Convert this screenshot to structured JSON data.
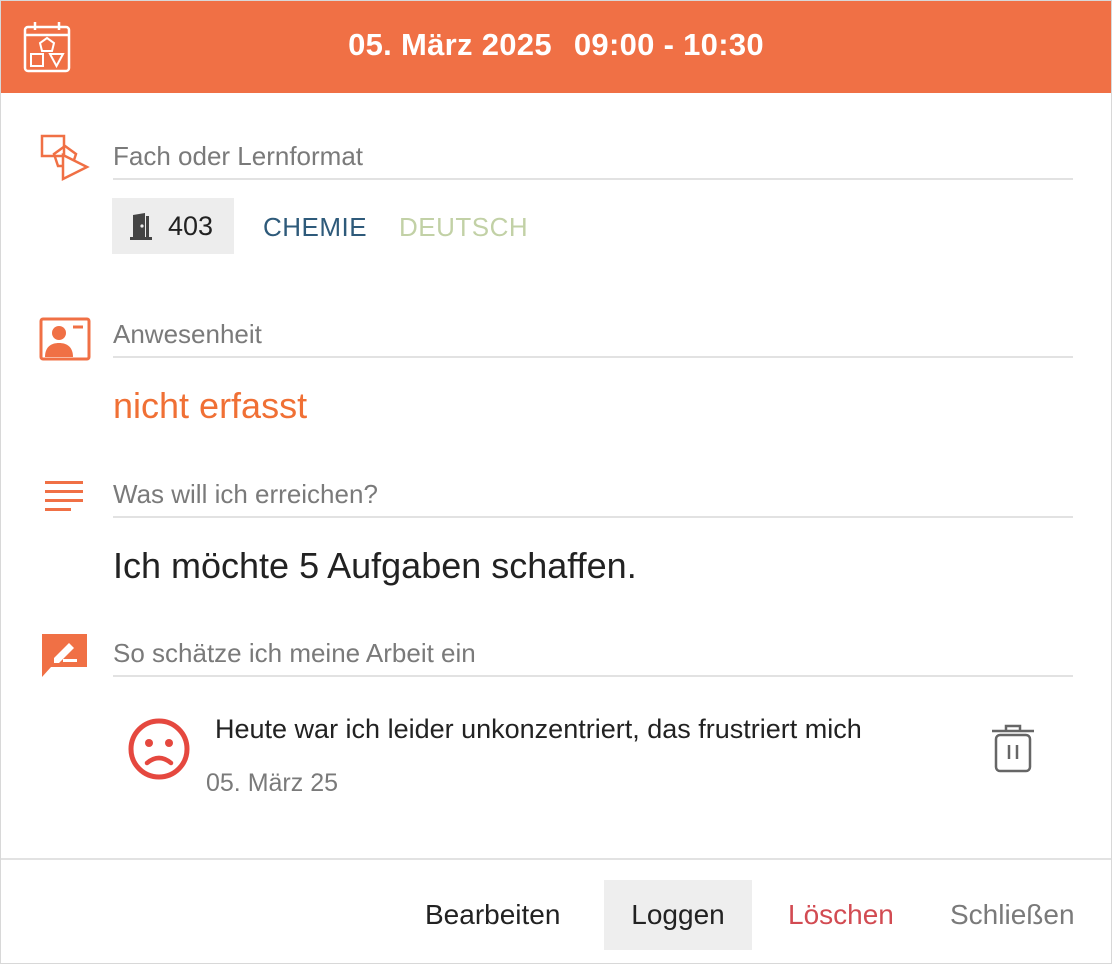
{
  "header": {
    "date": "05. März 2025",
    "time": "09:00 - 10:30",
    "background_color": "#f07045",
    "icon": "calendar-shapes-icon"
  },
  "subject_section": {
    "label": "Fach oder Lernformat",
    "icon": "shapes-icon",
    "room": {
      "icon": "door-icon",
      "number": "403"
    },
    "subjects": [
      {
        "name": "CHEMIE",
        "color": "#2e5a7a"
      },
      {
        "name": "DEUTSCH",
        "color": "#c2d1a6"
      }
    ]
  },
  "attendance_section": {
    "label": "Anwesenheit",
    "icon": "presentation-person-icon",
    "value": "nicht erfasst",
    "value_color": "#f07035"
  },
  "goal_section": {
    "label": "Was will ich erreichen?",
    "icon": "text-lines-icon",
    "value": "Ich möchte 5 Aufgaben schaffen."
  },
  "assessment_section": {
    "label": "So schätze ich meine Arbeit ein",
    "icon": "comment-edit-icon",
    "entry": {
      "mood_icon": "sad-face-icon",
      "mood_color": "#e5483f",
      "text": "Heute war ich leider unkonzentriert, das frustriert mich",
      "date": "05. März 25",
      "delete_icon": "trash-icon"
    }
  },
  "footer": {
    "edit_label": "Bearbeiten",
    "log_label": "Loggen",
    "delete_label": "Löschen",
    "close_label": "Schließen"
  }
}
